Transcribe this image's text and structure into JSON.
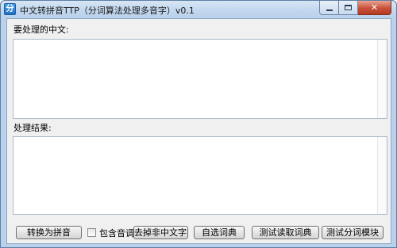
{
  "window": {
    "icon_glyph": "分",
    "title": "中文转拼音TTP（分词算法处理多音字）v0.1",
    "minimize": "minimize",
    "maximize": "maximize",
    "close": "x"
  },
  "input_section": {
    "label": "要处理的中文:",
    "value": ""
  },
  "output_section": {
    "label": "处理结果:",
    "value": ""
  },
  "toolbar": {
    "convert_button": "转换为拼音",
    "include_tone_checkbox": {
      "label": "包含音调",
      "checked": false
    },
    "remove_non_chinese_button": "去掉非中文字符",
    "custom_dict_button": "自选词典",
    "test_read_dict_button": "测试读取词典",
    "test_segment_button": "测试分词模块"
  },
  "colors": {
    "titlebar": "#c2d7ee",
    "client_bg": "#f0f0f0",
    "close_button": "#c7503a"
  }
}
